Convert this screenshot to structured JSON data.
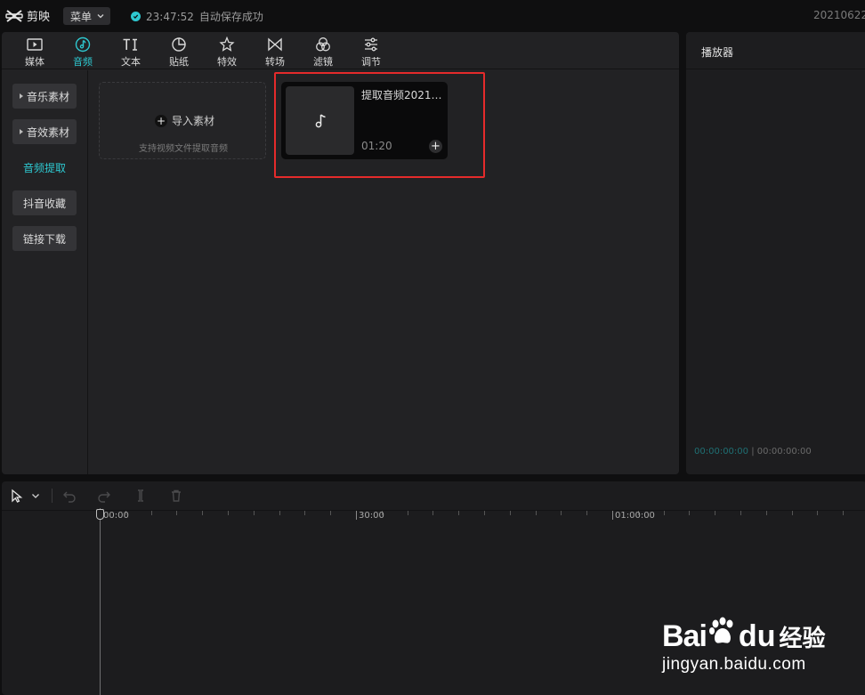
{
  "titlebar": {
    "app_name": "剪映",
    "menu_label": "菜单",
    "save_time": "23:47:52",
    "save_text": "自动保存成功",
    "project_name": "20210622"
  },
  "tabs": [
    {
      "label": "媒体",
      "icon": "media-icon",
      "active": false
    },
    {
      "label": "音频",
      "icon": "audio-icon",
      "active": true
    },
    {
      "label": "文本",
      "icon": "text-icon",
      "active": false
    },
    {
      "label": "贴纸",
      "icon": "sticker-icon",
      "active": false
    },
    {
      "label": "特效",
      "icon": "effects-icon",
      "active": false
    },
    {
      "label": "转场",
      "icon": "transition-icon",
      "active": false
    },
    {
      "label": "滤镜",
      "icon": "filter-icon",
      "active": false
    },
    {
      "label": "调节",
      "icon": "adjust-icon",
      "active": false
    }
  ],
  "sidebar": {
    "items": [
      {
        "label": "音乐素材",
        "expandable": true,
        "active": false
      },
      {
        "label": "音效素材",
        "expandable": true,
        "active": false
      },
      {
        "label": "音频提取",
        "expandable": false,
        "active": true
      },
      {
        "label": "抖音收藏",
        "expandable": false,
        "active": false
      },
      {
        "label": "链接下载",
        "expandable": false,
        "active": false
      }
    ]
  },
  "import": {
    "label": "导入素材",
    "hint": "支持视频文件提取音频"
  },
  "audio_item": {
    "name": "提取音频20210...",
    "duration": "01:20"
  },
  "player": {
    "title": "播放器",
    "current_time": "00:00:00:00",
    "total_time": "00:00:00:00"
  },
  "timeline": {
    "ruler_labels": [
      "00:00",
      "30:00",
      "01:00:00"
    ]
  },
  "watermark": {
    "brand_bai": "Bai",
    "brand_du": "du",
    "brand_cn": "经验",
    "url": "jingyan.baidu.com"
  },
  "colors": {
    "accent": "#2ec8d0",
    "highlight": "#e52b2b",
    "panel": "#222224",
    "background": "#0f0f10"
  }
}
